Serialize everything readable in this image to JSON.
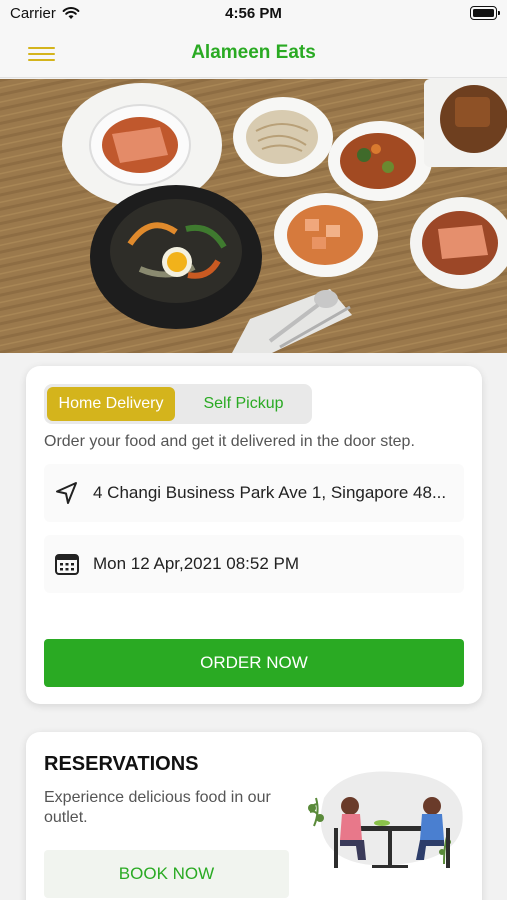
{
  "status_bar": {
    "carrier": "Carrier",
    "time": "4:56 PM"
  },
  "nav": {
    "title": "Alameen Eats"
  },
  "delivery": {
    "tabs": [
      {
        "label": "Home Delivery",
        "active": true
      },
      {
        "label": "Self Pickup",
        "active": false
      }
    ],
    "description": "Order your food and get it delivered in the door step.",
    "address": "4 Changi Business Park Ave 1, Singapore 48...",
    "datetime": "Mon 12 Apr,2021 08:52 PM",
    "order_button": "ORDER NOW"
  },
  "reservations": {
    "title": "RESERVATIONS",
    "description": "Experience delicious food in our outlet.",
    "book_button": "BOOK NOW"
  },
  "colors": {
    "brand_green": "#2aaa23",
    "accent_yellow": "#d4b41c"
  }
}
